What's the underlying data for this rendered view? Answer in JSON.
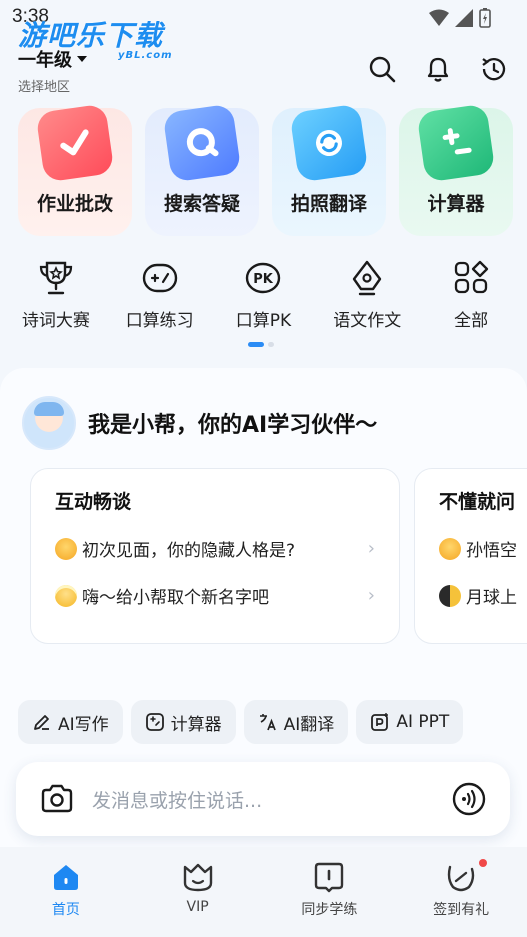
{
  "status": {
    "time": "3:38"
  },
  "watermark": {
    "main": "游吧乐下载",
    "sub": "yBL.com"
  },
  "header": {
    "grade": "一年级",
    "region": "选择地区"
  },
  "feature_cards": [
    {
      "label": "作业批改",
      "icon": "check-icon"
    },
    {
      "label": "搜索答疑",
      "icon": "search-icon"
    },
    {
      "label": "拍照翻译",
      "icon": "refresh-icon"
    },
    {
      "label": "计算器",
      "icon": "plus-minus-icon"
    }
  ],
  "tools": [
    {
      "label": "诗词大赛",
      "icon": "trophy-icon"
    },
    {
      "label": "口算练习",
      "icon": "gamepad-icon"
    },
    {
      "label": "口算PK",
      "icon": "pk-icon"
    },
    {
      "label": "语文作文",
      "icon": "pen-nib-icon"
    },
    {
      "label": "全部",
      "icon": "grid-icon"
    }
  ],
  "ai": {
    "title": "我是小帮，你的AI学习伙伴～",
    "cards": [
      {
        "heading": "互动畅谈",
        "rows": [
          "初次见面，你的隐藏人格是?",
          "嗨～给小帮取个新名字吧"
        ]
      },
      {
        "heading": "不懂就问",
        "rows": [
          "孙悟空",
          "月球上"
        ]
      }
    ]
  },
  "chips": [
    {
      "label": "AI写作",
      "icon": "pen-icon"
    },
    {
      "label": "计算器",
      "icon": "calculator-icon"
    },
    {
      "label": "AI翻译",
      "icon": "translate-icon"
    },
    {
      "label": "AI PPT",
      "icon": "ppt-icon"
    }
  ],
  "input": {
    "placeholder": "发消息或按住说话..."
  },
  "nav": [
    {
      "label": "首页",
      "active": true
    },
    {
      "label": "VIP"
    },
    {
      "label": "同步学练"
    },
    {
      "label": "签到有礼"
    }
  ],
  "colors": {
    "accent": "#1e88f2",
    "background": "#f3f7fc"
  }
}
